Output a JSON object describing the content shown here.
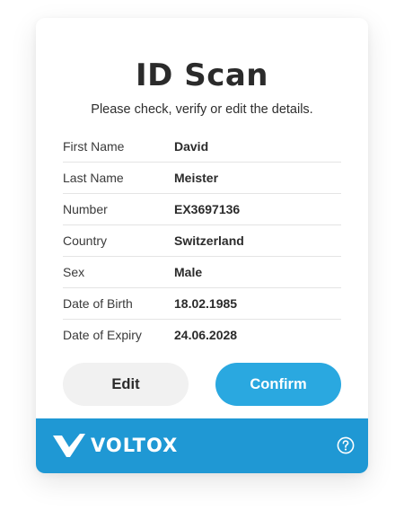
{
  "title": "ID Scan",
  "subtitle": "Please check, verify or edit the details.",
  "fields": [
    {
      "label": "First Name",
      "value": "David"
    },
    {
      "label": "Last Name",
      "value": "Meister"
    },
    {
      "label": "Number",
      "value": "EX3697136"
    },
    {
      "label": "Country",
      "value": "Switzerland"
    },
    {
      "label": "Sex",
      "value": "Male"
    },
    {
      "label": "Date of Birth",
      "value": "18.02.1985"
    },
    {
      "label": "Date of Expiry",
      "value": "24.06.2028"
    }
  ],
  "buttons": {
    "edit_label": "Edit",
    "confirm_label": "Confirm"
  },
  "footer": {
    "brand": "VOLTOX",
    "logo_icon": "voltox-v-icon",
    "help_icon": "help-icon"
  },
  "colors": {
    "accent": "#2aa8e0",
    "footer_bg": "#1f98d4",
    "edit_bg": "#f1f1f1",
    "text": "#2b2b2b"
  }
}
